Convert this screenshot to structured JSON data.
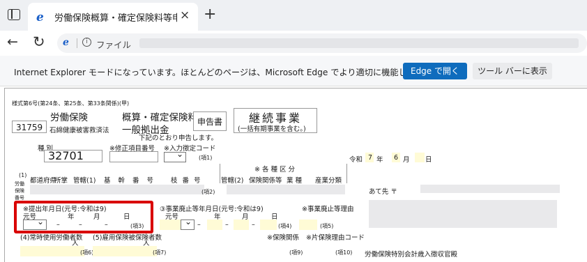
{
  "tab": {
    "title": "労働保険概算・確定保険料等申告書",
    "close": "×"
  },
  "newtab": "+",
  "nav": {
    "back": "←",
    "reload": "↻",
    "addr_label": "ファイル",
    "info": "i"
  },
  "banner": {
    "text": "Internet Explorer モードになっています。ほとんどのページは、Microsoft Edge でより適切に機能します。",
    "open_button": "Edge で開く",
    "toolbar_button": "ツール バーに表示"
  },
  "form": {
    "form_number": "様式第6号(第24条、第25条、第33条関係)(甲)",
    "code": "31759",
    "insurance_name": "労働保険",
    "sub_relief": "石綿健康被害救済法",
    "doc_type_1": "概算・確定保険料",
    "doc_type_2": "一般拠出金",
    "application": "申告書",
    "business_type": "継続事業",
    "business_note": "(一括有期事業を含む。)",
    "declare_text": "下記のとおり申告します。",
    "category_label": "種 別",
    "category_value": "32701",
    "correction_label": "※修正項目番号",
    "input_code_label": "※入力徴定コード",
    "item1": "(項1)",
    "date_era": "令和",
    "date_year": "7",
    "year_unit": "年",
    "date_month": "6",
    "month_unit": "月",
    "day_unit": "日",
    "sections_label": "※ 各 種 区 分",
    "col_header_1": "(1)",
    "col_header_2": "労働保険番号",
    "col_prefecture": "都道府県",
    "col_office": "所掌",
    "col_jurisdiction": "管轄(1)",
    "col_basic": "基 幹 番 号",
    "col_branch": "枝 番 号",
    "col_jurisdiction2": "管轄(2)",
    "col_insurance_rel": "保険関係等",
    "col_industry": "業 種",
    "col_category": "産業分類",
    "item2": "(項2)",
    "address_label": "あて先 〒",
    "submit_date_label": "※提出年月日(元号:令和は9)",
    "era_label": "元号",
    "year_label": "年",
    "month_label": "月",
    "day_label": "日",
    "dash": "–",
    "item3": "(項3)",
    "abolish_date_label": "③事業廃止等年月日(元号:令和は9)",
    "item4": "(項4)",
    "abolish_reason_label": "※事業廃止等理由",
    "item5": "(項5)",
    "workers_label": "(4)常時使用労働者数",
    "workers_unit": "人",
    "item6": "(項6)",
    "employed_label": "(5)雇用保険被保険者数",
    "employed_unit": "人",
    "item7": "(項7)",
    "insurance_rel_label": "※保険関係",
    "item9": "(項9)",
    "reason_code_label": "※片保険理由コード",
    "item10": "(項10)",
    "revenue_label": "労働保険特別会計歳入徴収官殿"
  }
}
